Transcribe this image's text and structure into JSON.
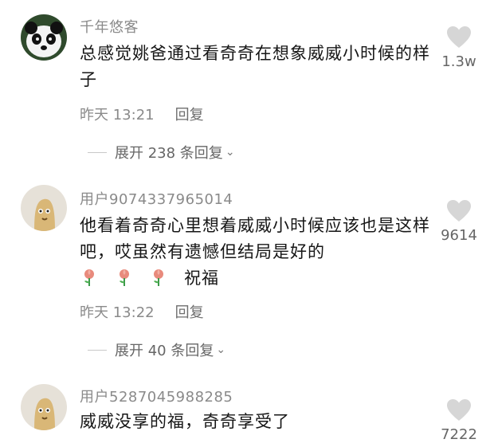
{
  "comments": [
    {
      "username": "千年悠客",
      "text": "总感觉姚爸通过看奇奇在想象威威小时候的样子",
      "time": "昨天 13:21",
      "reply_label": "回复",
      "expand_label": "展开 238 条回复",
      "likes": "1.3w",
      "avatar": "panda-avatar"
    },
    {
      "username": "用户9074337965014",
      "text": "他看着奇奇心里想着威威小时候应该也是这样吧，哎虽然有遗憾但结局是好的",
      "emoji_icon": "rose-icon",
      "emoji_suffix": "祝福",
      "time": "昨天 13:22",
      "reply_label": "回复",
      "expand_label": "展开 40 条回复",
      "likes": "9614",
      "avatar": "default-avatar"
    },
    {
      "username": "用户5287045988285",
      "text": "威威没享的福，奇奇享受了",
      "likes": "7222",
      "avatar": "default-avatar"
    }
  ]
}
